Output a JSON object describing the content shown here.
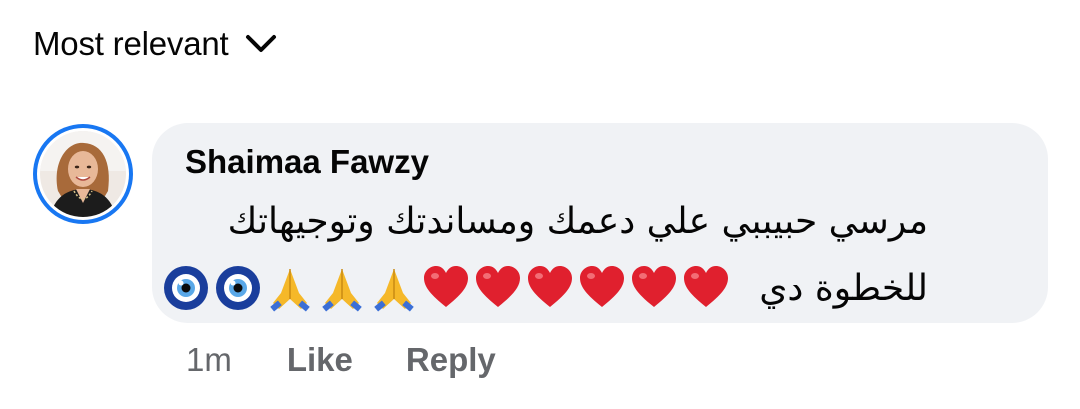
{
  "sort": {
    "label": "Most relevant",
    "icon": "chevron-down-icon"
  },
  "comment": {
    "author": "Shaimaa Fawzy",
    "text_line1": "مرسي حبيببي علي دعمك ومساندتك وتوجيهاتك",
    "text_line2": "للخطوة دي",
    "emojis": [
      "red-heart",
      "red-heart",
      "red-heart",
      "red-heart",
      "red-heart",
      "red-heart",
      "folded-hands",
      "folded-hands",
      "folded-hands",
      "nazar-amulet",
      "nazar-amulet"
    ],
    "time": "1m",
    "like_label": "Like",
    "reply_label": "Reply"
  },
  "colors": {
    "bubble": "#f0f2f5",
    "avatar_ring": "#1877f2",
    "secondary_text": "#65676b",
    "heart": "#e0202e",
    "hands": "#f5b829",
    "nazar_blue": "#1a3e9c"
  }
}
